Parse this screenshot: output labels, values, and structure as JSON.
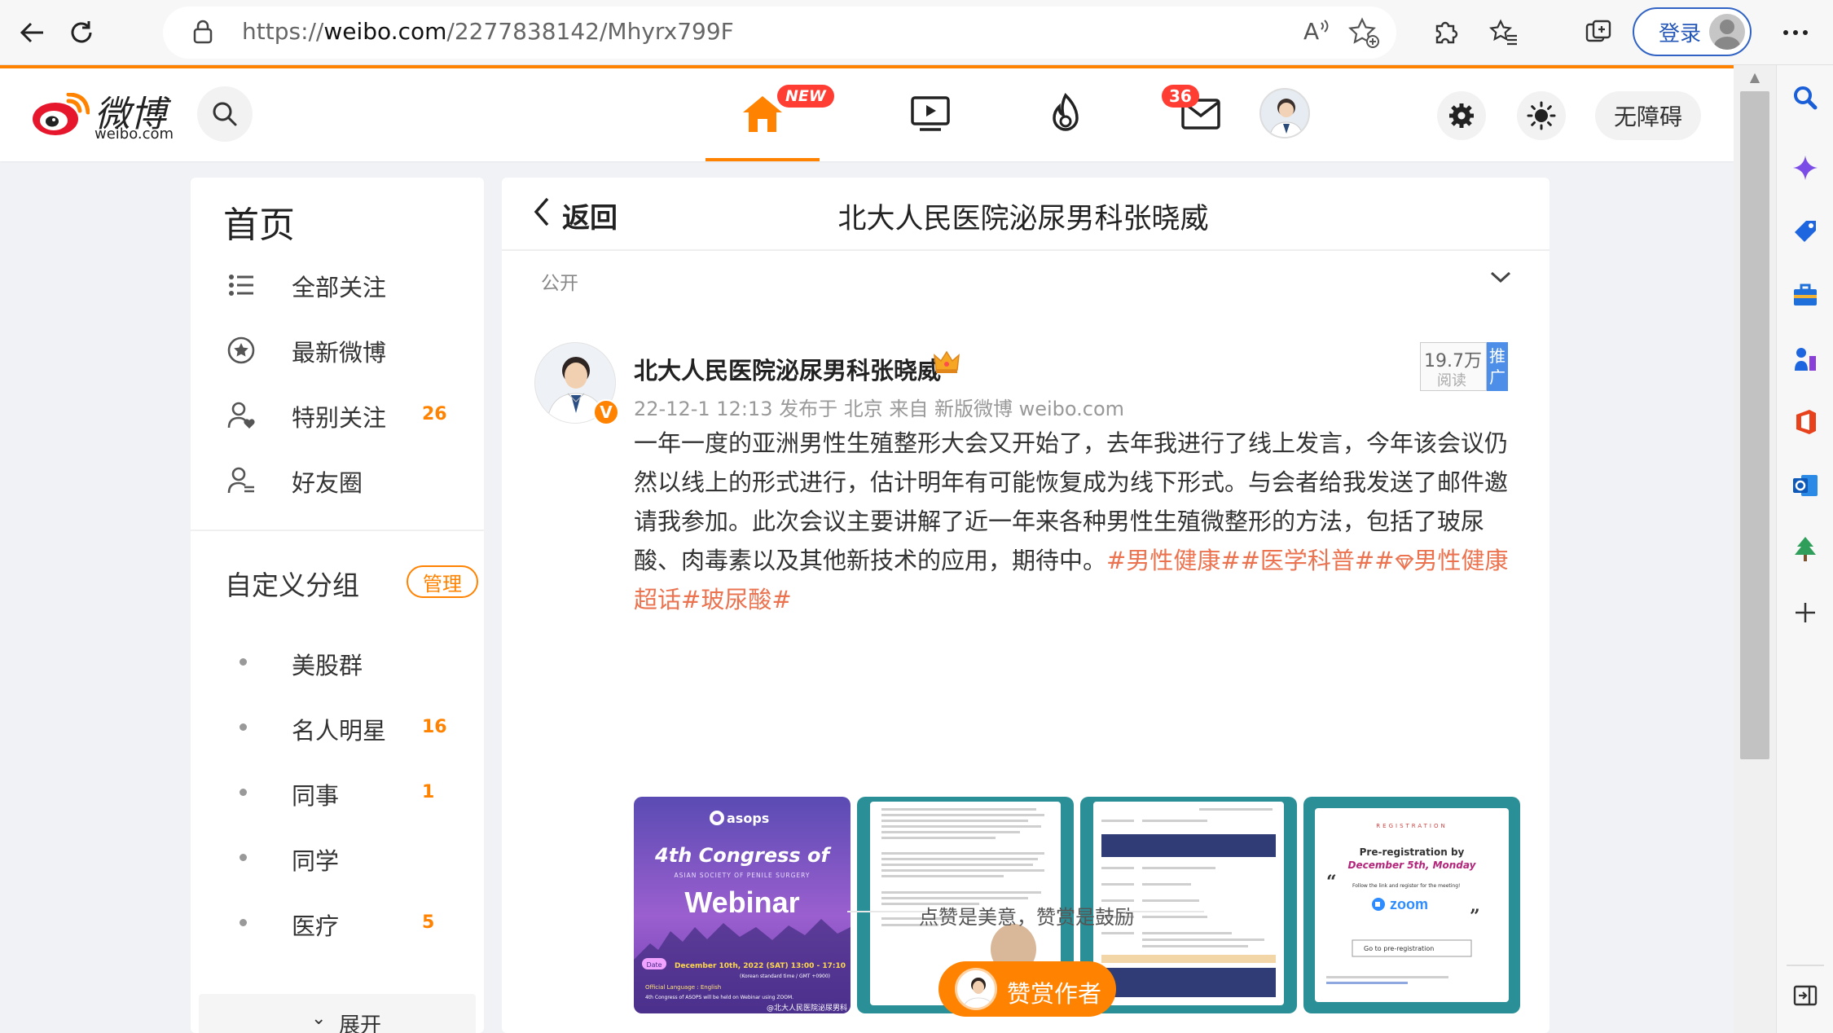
{
  "browser": {
    "url_scheme": "https://",
    "url_host": "weibo.com",
    "url_path": "/2277838142/Mhyrx799F",
    "login_label": "登录"
  },
  "nav": {
    "logo_text": "微博",
    "logo_sub": "weibo.com",
    "home_badge": "NEW",
    "mail_badge": "36",
    "accessibility_label": "无障碍"
  },
  "sidebar": {
    "title": "首页",
    "items": [
      {
        "label": "全部关注",
        "count": ""
      },
      {
        "label": "最新微博",
        "count": ""
      },
      {
        "label": "特别关注",
        "count": "26"
      },
      {
        "label": "好友圈",
        "count": ""
      }
    ],
    "custom_title": "自定义分组",
    "manage_label": "管理",
    "groups": [
      {
        "label": "美股群",
        "count": ""
      },
      {
        "label": "名人明星",
        "count": "16"
      },
      {
        "label": "同事",
        "count": "1"
      },
      {
        "label": "同学",
        "count": ""
      },
      {
        "label": "医疗",
        "count": "5"
      }
    ],
    "expand_label": "展开"
  },
  "main": {
    "back_label": "返回",
    "page_title": "北大人民医院泌尿男科张晓威",
    "visibility": "公开",
    "post": {
      "author": "北大人民医院泌尿男科张晓威",
      "meta": "22-12-1 12:13 发布于 北京  来自 新版微博 weibo.com",
      "read_count": "19.7万",
      "read_label": "阅读",
      "promo_label": "推广",
      "text": "一年一度的亚洲男性生殖整形大会又开始了，去年我进行了线上发言，今年该会议仍然以线上的形式进行，估计明年有可能恢复成为线下形式。与会者给我发送了邮件邀请我参加。此次会议主要讲解了近一年来各种男性生殖微整形的方法，包括了玻尿酸、肉毒素以及其他新技术的应用，期待中。",
      "tags": [
        "#男性健康#",
        "#医学科普#",
        "#",
        "男性健康超话",
        "#玻尿酸#"
      ],
      "images": {
        "img1": {
          "brand": "asops",
          "line1": "4th Congress of",
          "line2": "ASIAN SOCIETY OF PENILE SURGERY",
          "line3": "Webinar",
          "date_label": "Date",
          "date_text": "December 10th, 2022 (SAT) 13:00 - 17:10",
          "date_sub": "(Korean standard time / GMT +0900)",
          "bullet1": "Official Language : English",
          "bullet2": "4th Congress of ASOPS will be held on Webinar using ZOOM.",
          "watermark": "@北大人民医院泌尿男科"
        },
        "img4": {
          "heading": "REGISTRATION",
          "title": "Pre-registration by",
          "subtitle": "December 5th, Monday",
          "follow": "Follow the link and register for the meeting!",
          "zoom": "zoom",
          "button": "Go to pre-registration"
        }
      }
    },
    "like_text": "点赞是美意，赞赏是鼓励",
    "reward_label": "赞赏作者"
  }
}
